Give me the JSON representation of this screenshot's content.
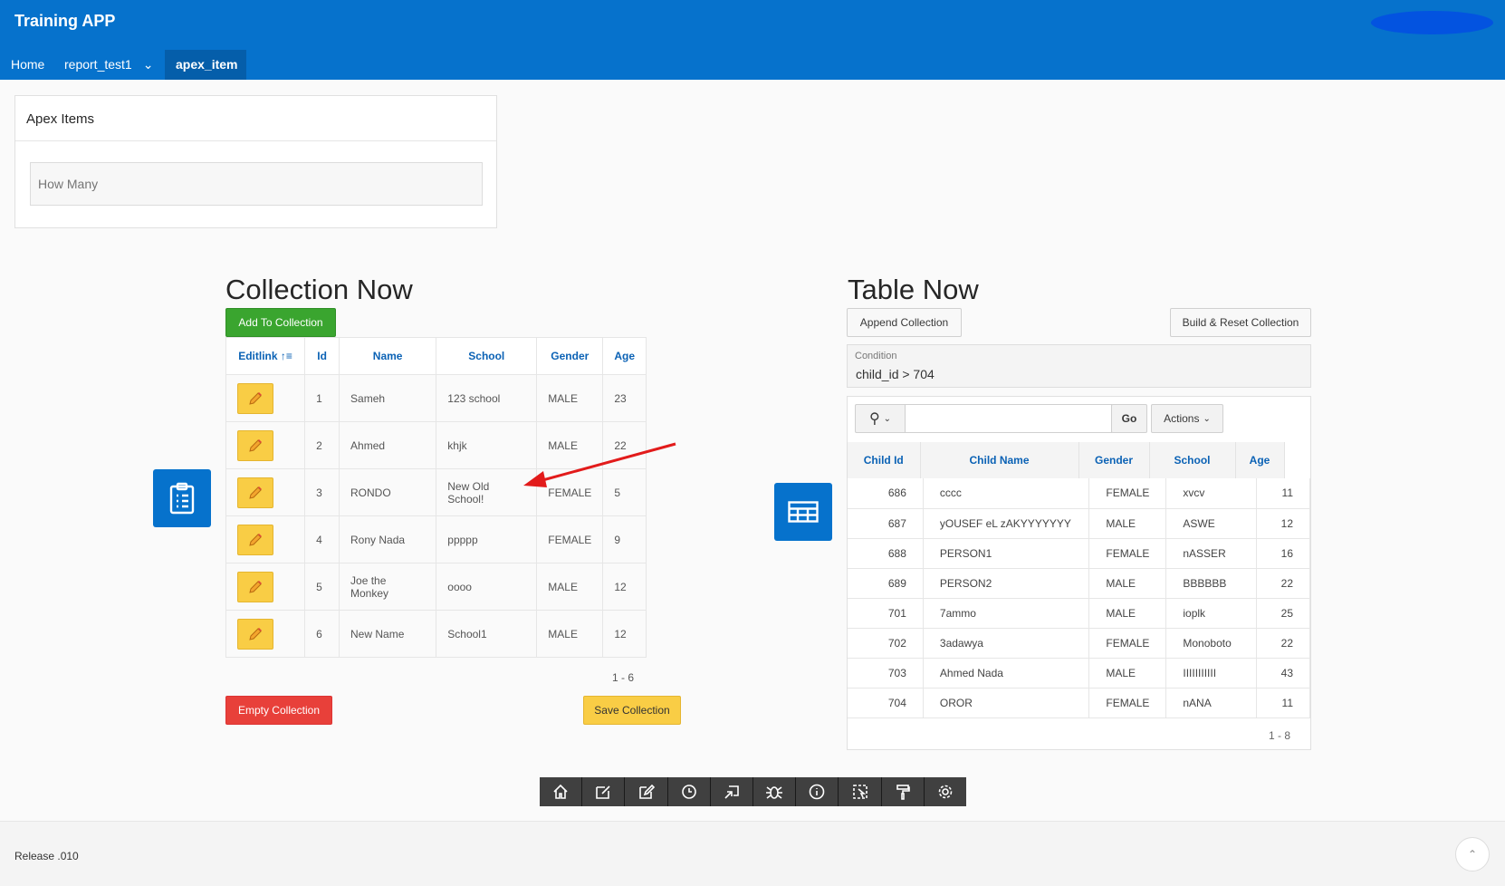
{
  "header": {
    "app_title": "Training APP",
    "nav": [
      {
        "label": "Home"
      },
      {
        "label": "report_test1"
      },
      {
        "label": "apex_item"
      }
    ]
  },
  "apex_items": {
    "title": "Apex Items",
    "how_many_placeholder": "How Many"
  },
  "collection": {
    "title": "Collection Now",
    "add_label": "Add To Collection",
    "columns": [
      "Editlink",
      "Id",
      "Name",
      "School",
      "Gender",
      "Age"
    ],
    "rows": [
      [
        "1",
        "Sameh",
        "123 school",
        "MALE",
        "23"
      ],
      [
        "2",
        "Ahmed",
        "khjk",
        "MALE",
        "22"
      ],
      [
        "3",
        "RONDO",
        "New Old School!",
        "FEMALE",
        "5"
      ],
      [
        "4",
        "Rony Nada",
        "ppppp",
        "FEMALE",
        "9"
      ],
      [
        "5",
        "Joe the Monkey",
        "oooo",
        "MALE",
        "12"
      ],
      [
        "6",
        "New Name",
        "School1",
        "MALE",
        "12"
      ]
    ],
    "pagination": "1 - 6",
    "empty_label": "Empty Collection",
    "save_label": "Save Collection"
  },
  "table_now": {
    "title": "Table Now",
    "append_label": "Append Collection",
    "build_label": "Build & Reset Collection",
    "condition_label": "Condition",
    "condition_value": "child_id > 704",
    "go_label": "Go",
    "actions_label": "Actions",
    "columns": [
      "Child Id",
      "Child Name",
      "Gender",
      "School",
      "Age"
    ],
    "rows": [
      [
        "686",
        "cccc",
        "FEMALE",
        "xvcv",
        "11"
      ],
      [
        "687",
        "yOUSEF eL zAKYYYYYYY",
        "MALE",
        "ASWE",
        "12"
      ],
      [
        "688",
        "PERSON1",
        "FEMALE",
        "nASSER",
        "16"
      ],
      [
        "689",
        "PERSON2",
        "MALE",
        "BBBBBB",
        "22"
      ],
      [
        "701",
        "7ammo",
        "MALE",
        "ioplk",
        "25"
      ],
      [
        "702",
        "3adawya",
        "FEMALE",
        "Monoboto",
        "22"
      ],
      [
        "703",
        "Ahmed Nada",
        "MALE",
        "IIIIIIIIIII",
        "43"
      ],
      [
        "704",
        "OROR",
        "FEMALE",
        "nANA",
        "11"
      ]
    ],
    "pagination": "1 - 8"
  },
  "footer": {
    "release": "Release .010"
  }
}
